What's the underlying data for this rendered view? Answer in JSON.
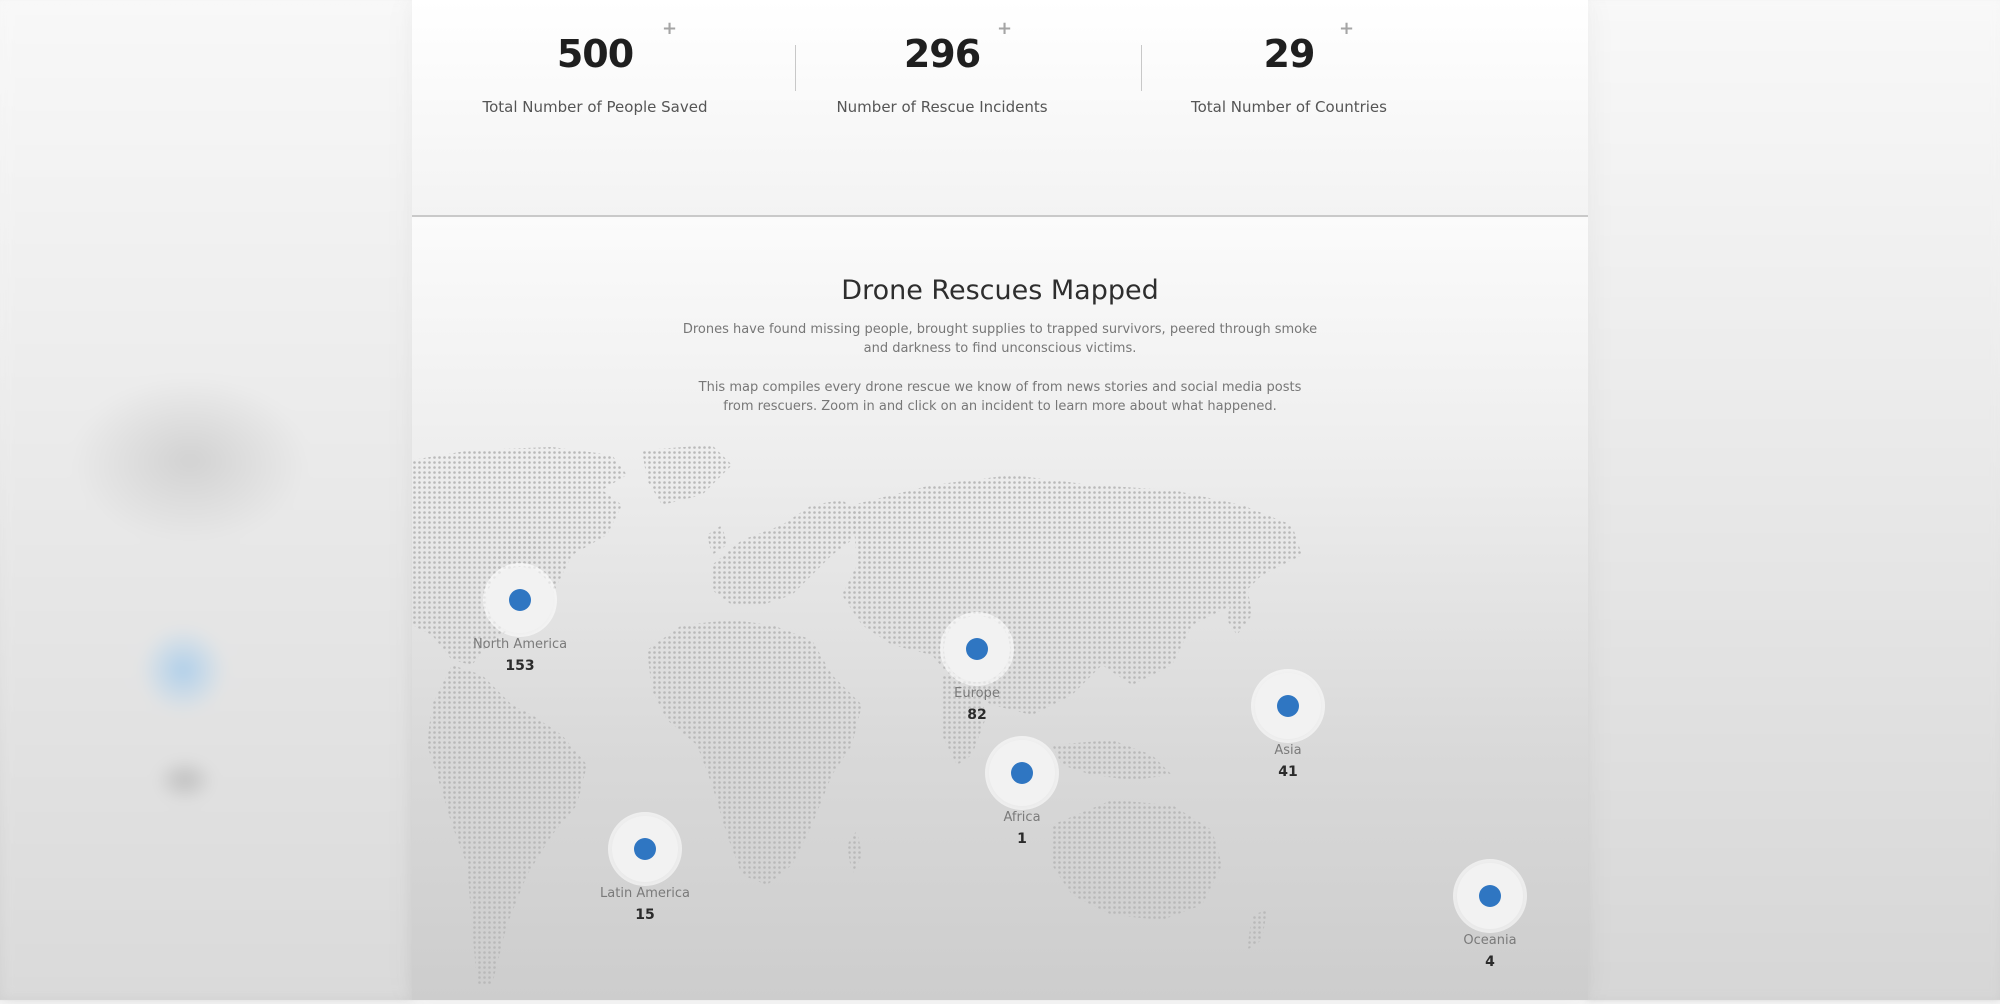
{
  "stats": [
    {
      "value": "500",
      "plus": "+",
      "label": "Total Number of People Saved"
    },
    {
      "value": "296",
      "plus": "+",
      "label": "Number of Rescue Incidents"
    },
    {
      "value": "29",
      "plus": "+",
      "label": "Total Number of Countries"
    }
  ],
  "section": {
    "title": "Drone Rescues Mapped",
    "paragraph1": "Drones have found missing people, brought supplies to trapped survivors, peered through smoke and darkness to find unconscious victims.",
    "paragraph2": "This map compiles every drone rescue we know of from news stories and social media posts from rescuers. Zoom in and click on an incident to learn more about what happened."
  },
  "regions": [
    {
      "name": "North America",
      "count": "153"
    },
    {
      "name": "Europe",
      "count": "82"
    },
    {
      "name": "Africa",
      "count": "1"
    },
    {
      "name": "Asia",
      "count": "41"
    },
    {
      "name": "Latin America",
      "count": "15"
    },
    {
      "name": "Oceania",
      "count": "4"
    }
  ],
  "colors": {
    "marker": "#2f76c2",
    "map_dots": "#b9b9b9"
  }
}
